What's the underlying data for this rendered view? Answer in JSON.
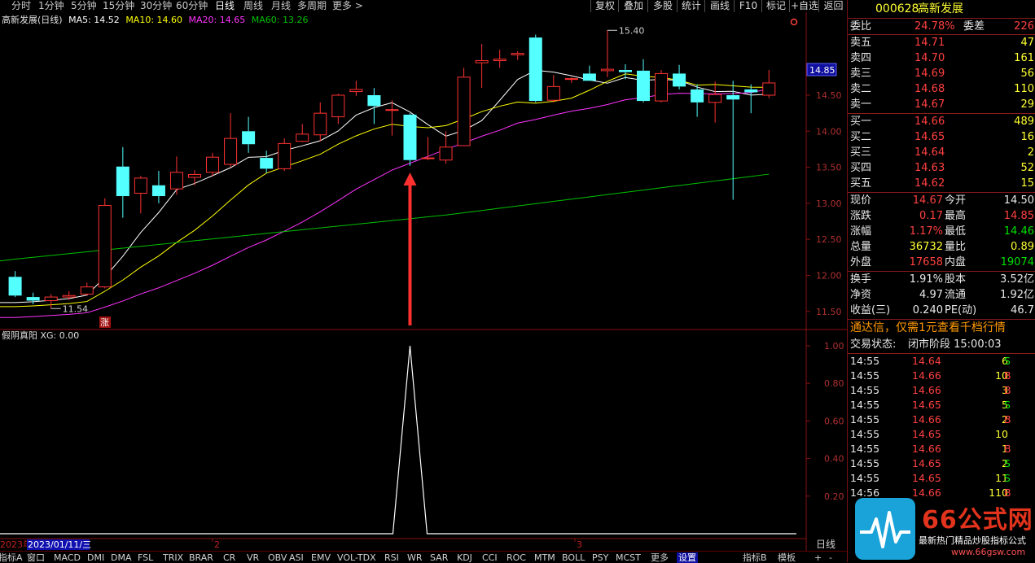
{
  "toolbar": {
    "periods": [
      "分时",
      "1分钟",
      "5分钟",
      "15分钟",
      "30分钟",
      "60分钟",
      "日线",
      "周线",
      "月线",
      "多周期",
      "更多 >"
    ],
    "active_period": "日线",
    "right_buttons": [
      "复权",
      "叠加",
      "多股",
      "统计",
      "画线",
      "F10",
      "标记",
      "+自选",
      "返回"
    ]
  },
  "main_legend": {
    "title": "高新发展(日线)",
    "ma5": "MA5: 14.52",
    "ma10": "MA10: 14.60",
    "ma20": "MA20: 14.65",
    "ma60": "MA60: 13.26"
  },
  "sub_legend": {
    "title": "假阴真阳 XG: 0.00"
  },
  "annotations": {
    "high": "15.40",
    "low": "11.54",
    "zhang": "涨",
    "current_price": "14.85"
  },
  "price_axis": [
    "14.50",
    "14.00",
    "13.50",
    "13.00",
    "12.50",
    "12.00",
    "11.50"
  ],
  "indicator_axis": [
    "1.00",
    "0.80",
    "0.60",
    "0.40",
    "0.20"
  ],
  "date_axis": {
    "start": "2023年",
    "selected": "2023/01/11/三",
    "m2": "2",
    "m3": "3",
    "period_label": "日线"
  },
  "bottom_tabs": [
    "指标A",
    "窗口",
    "MACD",
    "DMI",
    "DMA",
    "FSL",
    "TRIX",
    "BRAR",
    "CR",
    "VR",
    "OBV",
    "ASI",
    "EMV",
    "VOL-TDX",
    "RSI",
    "WR",
    "SAR",
    "KDJ",
    "CCI",
    "ROC",
    "MTM",
    "BOLL",
    "PSY",
    "MCST",
    "更多",
    "设置",
    "+",
    "-",
    "指标B",
    "模板"
  ],
  "quote": {
    "code": "000628",
    "name": "高新发展",
    "weibi_label": "委比",
    "weibi": "24.78%",
    "weicha_label": "委差",
    "weicha": "226",
    "sell": [
      {
        "label": "卖五",
        "price": "14.71",
        "vol": "47"
      },
      {
        "label": "卖四",
        "price": "14.70",
        "vol": "161"
      },
      {
        "label": "卖三",
        "price": "14.69",
        "vol": "56"
      },
      {
        "label": "卖二",
        "price": "14.68",
        "vol": "110"
      },
      {
        "label": "卖一",
        "price": "14.67",
        "vol": "29"
      }
    ],
    "buy": [
      {
        "label": "买一",
        "price": "14.66",
        "vol": "489"
      },
      {
        "label": "买二",
        "price": "14.65",
        "vol": "16"
      },
      {
        "label": "买三",
        "price": "14.64",
        "vol": "2"
      },
      {
        "label": "买四",
        "price": "14.63",
        "vol": "52"
      },
      {
        "label": "买五",
        "price": "14.62",
        "vol": "15"
      }
    ],
    "stats": [
      {
        "l1": "现价",
        "v1": "14.67",
        "l2": "今开",
        "v2": "14.50"
      },
      {
        "l1": "涨跌",
        "v1": "0.17",
        "l2": "最高",
        "v2": "14.85"
      },
      {
        "l1": "涨幅",
        "v1": "1.17%",
        "l2": "最低",
        "v2": "14.46"
      },
      {
        "l1": "总量",
        "v1": "36732",
        "l2": "量比",
        "v2": "0.89"
      },
      {
        "l1": "外盘",
        "v1": "17658",
        "l2": "内盘",
        "v2": "19074"
      }
    ],
    "info": [
      {
        "l1": "换手",
        "v1": "1.91%",
        "l2": "股本",
        "v2": "3.52亿"
      },
      {
        "l1": "净资",
        "v1": "4.97",
        "l2": "流通",
        "v2": "1.92亿"
      },
      {
        "l1": "收益(三)",
        "v1": "0.240",
        "l2": "PE(动)",
        "v2": "46.7"
      }
    ],
    "promo": "通达信，仅需1元查看千档行情",
    "trade_status_label": "交易状态:",
    "trade_status": "闭市阶段 15:00:03",
    "ticks": [
      {
        "t": "14:55",
        "p": "14.64",
        "v": "6",
        "d": "S"
      },
      {
        "t": "14:55",
        "p": "14.66",
        "v": "10",
        "d": "B"
      },
      {
        "t": "14:55",
        "p": "14.66",
        "v": "3",
        "d": "B"
      },
      {
        "t": "14:55",
        "p": "14.65",
        "v": "5",
        "d": "S"
      },
      {
        "t": "14:55",
        "p": "14.66",
        "v": "2",
        "d": "B"
      },
      {
        "t": "14:55",
        "p": "14.65",
        "v": "10",
        "d": ""
      },
      {
        "t": "14:55",
        "p": "14.66",
        "v": "1",
        "d": "B"
      },
      {
        "t": "14:55",
        "p": "14.65",
        "v": "2",
        "d": "S"
      },
      {
        "t": "14:55",
        "p": "14.65",
        "v": "11",
        "d": "S"
      },
      {
        "t": "14:56",
        "p": "14.66",
        "v": "110",
        "d": "B"
      }
    ]
  },
  "logo": {
    "main": "66公式网",
    "sub": "最新热门精品炒股指标公式",
    "url": "www.66gsw.com"
  },
  "colors": {
    "up": "#ff3232",
    "down": "#54ffff",
    "ma5": "#ffffff",
    "ma10": "#ffff00",
    "ma20": "#ff33ff",
    "ma60": "#00c000",
    "signal": "#ffffff"
  },
  "chart_data": {
    "type": "candlestick",
    "candles": [
      [
        11.98,
        11.72,
        12.06,
        11.7
      ],
      [
        11.7,
        11.65,
        11.76,
        11.6
      ],
      [
        11.65,
        11.7,
        11.74,
        11.54
      ],
      [
        11.7,
        11.72,
        11.78,
        11.66
      ],
      [
        11.74,
        11.84,
        11.9,
        11.72
      ],
      [
        11.84,
        12.97,
        13.07,
        11.82
      ],
      [
        13.51,
        13.1,
        13.78,
        12.8
      ],
      [
        13.14,
        13.35,
        13.38,
        12.86
      ],
      [
        13.25,
        13.1,
        13.45,
        13.0
      ],
      [
        13.2,
        13.43,
        13.65,
        13.12
      ],
      [
        13.36,
        13.4,
        13.46,
        13.25
      ],
      [
        13.43,
        13.64,
        13.7,
        13.37
      ],
      [
        13.54,
        13.9,
        14.25,
        13.5
      ],
      [
        14.0,
        13.82,
        14.2,
        13.7
      ],
      [
        13.63,
        13.48,
        13.73,
        13.42
      ],
      [
        13.48,
        13.83,
        13.9,
        13.45
      ],
      [
        13.86,
        13.96,
        14.1,
        13.85
      ],
      [
        13.95,
        14.25,
        14.4,
        13.86
      ],
      [
        14.2,
        14.5,
        14.52,
        14.1
      ],
      [
        14.55,
        14.58,
        14.7,
        14.49
      ],
      [
        14.5,
        14.35,
        14.6,
        14.1
      ],
      [
        14.3,
        14.3,
        14.43,
        13.94
      ],
      [
        14.23,
        13.6,
        14.25,
        13.52
      ],
      [
        13.62,
        13.63,
        13.92,
        13.6
      ],
      [
        13.6,
        13.78,
        14.0,
        13.55
      ],
      [
        13.8,
        14.75,
        14.88,
        13.8
      ],
      [
        14.95,
        14.98,
        15.21,
        14.6
      ],
      [
        14.98,
        15.0,
        15.13,
        14.88
      ],
      [
        15.06,
        15.08,
        15.11,
        14.99
      ],
      [
        15.3,
        14.42,
        15.34,
        14.4
      ],
      [
        14.43,
        14.62,
        14.78,
        14.4
      ],
      [
        14.72,
        14.73,
        14.75,
        14.67
      ],
      [
        14.8,
        14.7,
        14.91,
        14.7
      ],
      [
        14.84,
        14.86,
        15.4,
        14.75
      ],
      [
        14.85,
        14.82,
        14.93,
        14.72
      ],
      [
        14.84,
        14.42,
        15.0,
        14.4
      ],
      [
        14.42,
        14.8,
        14.85,
        14.4
      ],
      [
        14.8,
        14.62,
        14.92,
        14.58
      ],
      [
        14.58,
        14.4,
        14.65,
        14.2
      ],
      [
        14.4,
        14.51,
        14.69,
        14.12
      ],
      [
        14.5,
        14.44,
        14.7,
        13.05
      ],
      [
        14.58,
        14.54,
        14.65,
        14.25
      ],
      [
        14.5,
        14.67,
        14.85,
        14.46
      ]
    ],
    "signal": {
      "index": 22,
      "value": 1
    }
  }
}
